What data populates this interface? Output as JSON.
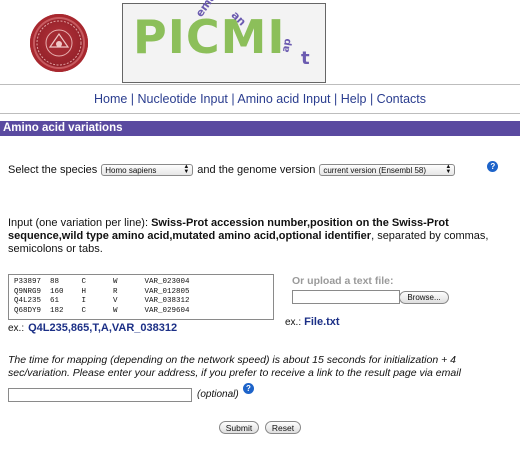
{
  "logos": {
    "left_seal": "university-seal",
    "banner_text": "PICMI",
    "banner_small_1": "emaps",
    "banner_small_2": "an",
    "banner_small_3": "ap",
    "banner_suffix": "t"
  },
  "nav": {
    "items": [
      "Home",
      "Nucleotide Input",
      "Amino acid Input",
      "Help",
      "Contacts"
    ],
    "separator": "|"
  },
  "section_title": "Amino acid variations",
  "species_row": {
    "label_before": "Select the species",
    "species_value": "Homo sapiens",
    "label_middle": "and the genome version",
    "genome_value": "current version (Ensembl 58)",
    "help_icon": "?"
  },
  "input_description": {
    "prefix": "Input (one variation per line): ",
    "bold": "Swiss-Prot accession number,position on the Swiss-Prot sequence,wild type amino acid,mutated amino acid,optional identifier",
    "suffix": ", separated by commas, semicolons or tabs."
  },
  "textarea_lines": [
    "P33897  88     C      W      VAR_023004",
    "Q9NRG9  160    H      R      VAR_012805",
    "Q4L235  61     I      V      VAR_038312",
    "Q68DY9  182    C      W      VAR_029604"
  ],
  "example_input": {
    "label": "ex.:",
    "value": "Q4L235,865,T,A,VAR_038312"
  },
  "upload": {
    "label": "Or upload a text file:",
    "browse_label": "Browse...",
    "example_label": "ex.:",
    "example_file": "File.txt"
  },
  "mapping_note": "The time for mapping (depending on the network speed) is about 15 seconds for initialization + 4 sec/variation. Please enter your address, if you prefer to receive a link to the result page via email",
  "email": {
    "value": "",
    "optional_label": "(optional)",
    "help_icon": "?"
  },
  "buttons": {
    "submit": "Submit",
    "reset": "Reset"
  },
  "colors": {
    "title_bar": "#5a4aa0",
    "nav_link": "#2a3d8f",
    "example_text": "#1b2f86",
    "help_icon": "#1d63c9"
  }
}
